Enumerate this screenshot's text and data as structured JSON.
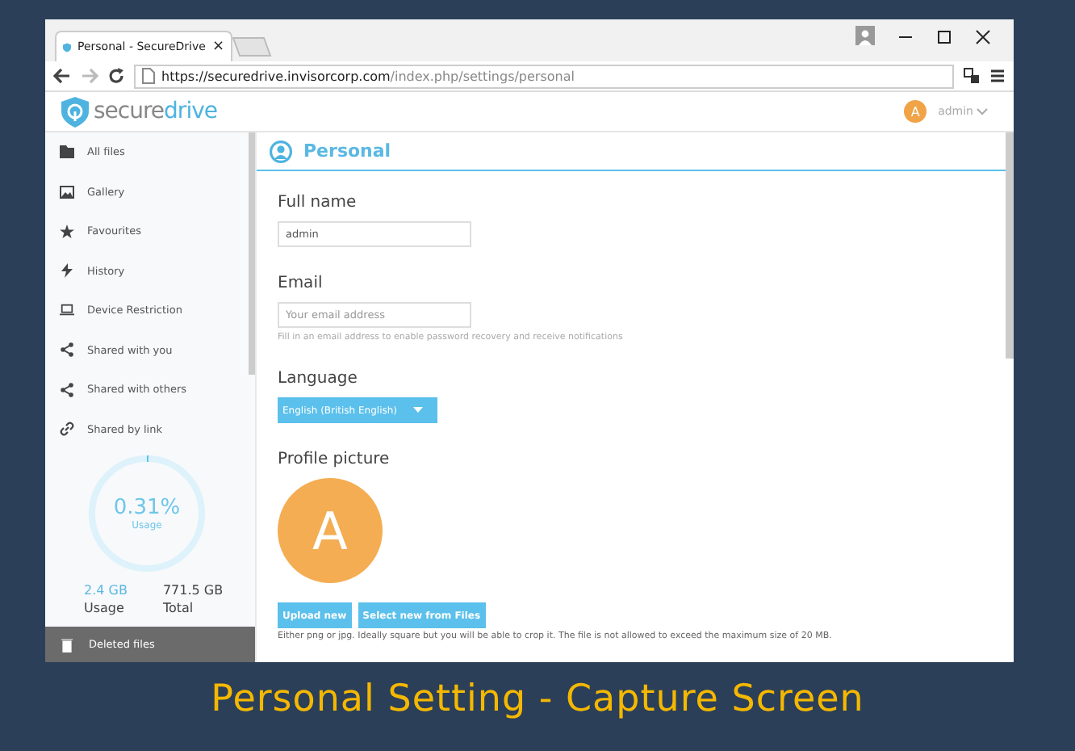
{
  "browser": {
    "tab_title": "Personal - SecureDrive",
    "tab_close": "×",
    "url_host": "https://securedrive.invisorcorp.com",
    "url_path": "/index.php/settings/personal"
  },
  "app": {
    "logo_plain": "secure",
    "logo_bold": "drive",
    "user_initial": "A",
    "user_name": "admin"
  },
  "sidebar": {
    "items": [
      {
        "label": "All files",
        "kind": "folder"
      },
      {
        "label": "Gallery",
        "kind": "image"
      },
      {
        "label": "Favourites",
        "kind": "star"
      },
      {
        "label": "History",
        "kind": "bolt"
      },
      {
        "label": "Device Restriction",
        "kind": "laptop"
      },
      {
        "label": "Shared with you",
        "kind": "share"
      },
      {
        "label": "Shared with others",
        "kind": "share"
      },
      {
        "label": "Shared by link",
        "kind": "link"
      }
    ],
    "usage": {
      "percent": "0.31%",
      "caption": "Usage",
      "level": 0.0031,
      "used": "2.4 GB",
      "used_label": "Usage",
      "total": "771.5 GB",
      "total_label": "Total"
    },
    "footer_item": "Deleted files"
  },
  "section": {
    "title": "Personal",
    "full_name": {
      "label": "Full name",
      "value": "admin"
    },
    "email": {
      "label": "Email",
      "placeholder": "Your email address",
      "hint": "Fill in an email address to enable password recovery and receive notifications"
    },
    "language": {
      "label": "Language",
      "value": "English (British English)"
    },
    "profile": {
      "label": "Profile picture",
      "initial": "A",
      "buttons": [
        "Upload new",
        "Select new from Files"
      ],
      "note": "Either png or jpg. Ideally square but you will be able to crop it. The file is not allowed to exceed the maximum size of 20 MB."
    }
  },
  "caption": "Personal Setting - Capture Screen"
}
